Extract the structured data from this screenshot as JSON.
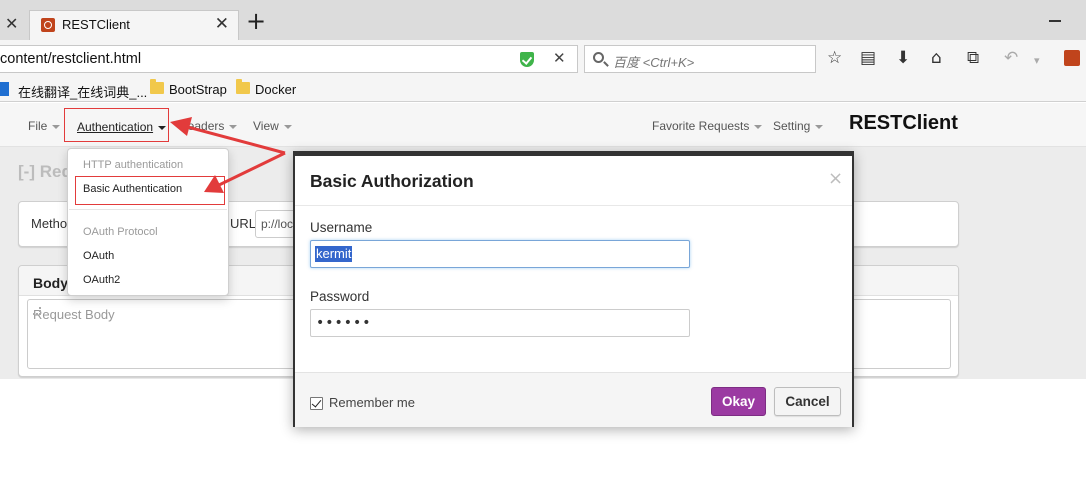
{
  "browser": {
    "tab_title": "RESTClient",
    "url": "content/restclient.html",
    "search_placeholder": "百度 <Ctrl+K>",
    "bookmarks": [
      "在线翻译_在线词典_...",
      "BootStrap",
      "Docker"
    ]
  },
  "app": {
    "brand": "RESTClient",
    "nav": {
      "file": "File",
      "authentication": "Authentication",
      "headers": "Headers",
      "view": "View",
      "favorite_requests": "Favorite Requests",
      "setting": "Setting"
    },
    "request_title": "[-] Req",
    "method_label": "Metho",
    "url_label": "URL",
    "url_value": "p://loc",
    "body_label": "Body",
    "body_placeholder": "Request Body"
  },
  "auth_menu": {
    "http_header": "HTTP authentication",
    "basic": "Basic Authentication",
    "oauth_header": "OAuth Protocol",
    "oauth": "OAuth",
    "oauth2": "OAuth2"
  },
  "modal": {
    "title": "Basic Authorization",
    "close": "×",
    "username_label": "Username",
    "username_value": "kermit",
    "password_label": "Password",
    "password_mask": "••••••",
    "remember_label": "Remember me",
    "remember_checked": true,
    "okay_label": "Okay",
    "cancel_label": "Cancel"
  },
  "colors": {
    "okay_button": "#9b3aa2",
    "annotation_red": "#e23b3b",
    "selection": "#3366cc"
  }
}
